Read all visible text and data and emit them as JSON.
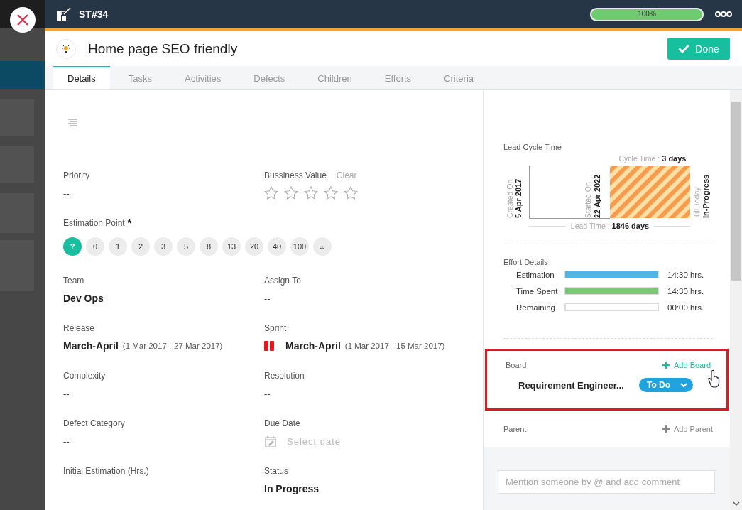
{
  "header": {
    "id": "ST#34",
    "progress": {
      "level": 1,
      "reading": "100%"
    }
  },
  "title": "Home page SEO friendly",
  "done_button": "Done",
  "tabs": [
    {
      "label": "Details",
      "selected": true
    },
    {
      "label": "Tasks",
      "selected": false
    },
    {
      "label": "Activities",
      "selected": false
    },
    {
      "label": "Defects",
      "selected": false
    },
    {
      "label": "Children",
      "selected": false
    },
    {
      "label": "Efforts",
      "selected": false
    },
    {
      "label": "Criteria",
      "selected": false
    }
  ],
  "fields": [
    {
      "kind": "text",
      "label": "Priority",
      "value": "--"
    },
    {
      "kind": "stars",
      "label": "Bussiness Value",
      "action": "Clear",
      "stars": 0
    },
    {
      "kind": "points",
      "label": "Estimation Point",
      "required_mark": "*",
      "points": [
        {
          "label": "?",
          "selected": true
        },
        {
          "label": "0",
          "selected": false
        },
        {
          "label": "1",
          "selected": false
        },
        {
          "label": "2",
          "selected": false
        },
        {
          "label": "3",
          "selected": false
        },
        {
          "label": "5",
          "selected": false
        },
        {
          "label": "8",
          "selected": false
        },
        {
          "label": "13",
          "selected": false
        },
        {
          "label": "20",
          "selected": false
        },
        {
          "label": "40",
          "selected": false
        },
        {
          "label": "100",
          "selected": false
        },
        {
          "label": "∞",
          "selected": false
        }
      ]
    },
    {
      "kind": "text",
      "label": "Team",
      "value": "Dev Ops"
    },
    {
      "kind": "text",
      "label": "Assign To",
      "value": "--"
    },
    {
      "kind": "range",
      "label": "Release",
      "value": "March-April",
      "range": "(1 Mar 2017 - 27 Mar 2017)"
    },
    {
      "kind": "sprint",
      "label": "Sprint",
      "value": "March-April",
      "range": "(1 Mar 2017 - 15 Mar 2017)"
    },
    {
      "kind": "text",
      "label": "Complexity",
      "value": "--"
    },
    {
      "kind": "text",
      "label": "Resolution",
      "value": "--"
    },
    {
      "kind": "text",
      "label": "Defect Category",
      "value": "--"
    },
    {
      "kind": "date",
      "label": "Due Date",
      "placeholder": "Select date"
    },
    {
      "kind": "label",
      "label": "Initial Estimation (Hrs.)"
    },
    {
      "kind": "text",
      "label": "Status",
      "value": "In Progress"
    }
  ],
  "lead_cycle": {
    "title": "Lead Cycle Time",
    "cycle_label": "Cycle Time :",
    "cycle_value": "3 days",
    "created_label": "Created On",
    "created_date": "5 Apr 2017",
    "started_label": "Started On",
    "started_date": "22 Apr 2022",
    "today_label": "Till Today",
    "today_state": "In-Progress",
    "lead_label": "Lead Time :",
    "lead_value": "1846 days"
  },
  "effort": {
    "title": "Effort Details",
    "rows": [
      {
        "name": "Estimation",
        "level": 1,
        "color": "#4fb7e6",
        "reading": "14:30 hrs."
      },
      {
        "name": "Time Spent",
        "level": 1,
        "color": "#76c979",
        "reading": "14:30 hrs."
      },
      {
        "name": "Remaining",
        "level": 0,
        "reading": "00:00 hrs."
      }
    ]
  },
  "board": {
    "label": "Board",
    "add": "Add Board",
    "name": "Requirement Engineer...",
    "status": "To Do"
  },
  "parent": {
    "label": "Parent",
    "add": "Add Parent"
  },
  "comment": {
    "placeholder": "Mention someone by @ and add comment"
  }
}
